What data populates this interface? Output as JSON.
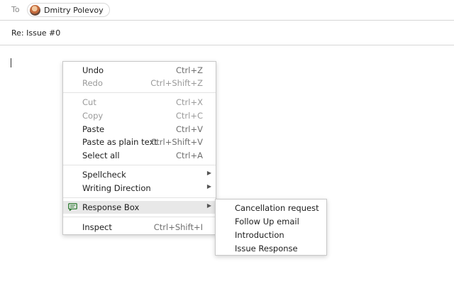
{
  "header": {
    "to_label": "To",
    "recipient_name": "Dmitry Polevoy",
    "subject": "Re: Issue #0"
  },
  "context_menu": {
    "items": [
      {
        "label": "Undo",
        "shortcut": "Ctrl+Z",
        "enabled": true
      },
      {
        "label": "Redo",
        "shortcut": "Ctrl+Shift+Z",
        "enabled": false
      },
      {
        "label": "Cut",
        "shortcut": "Ctrl+X",
        "enabled": false
      },
      {
        "label": "Copy",
        "shortcut": "Ctrl+C",
        "enabled": false
      },
      {
        "label": "Paste",
        "shortcut": "Ctrl+V",
        "enabled": true
      },
      {
        "label": "Paste as plain text",
        "shortcut": "Ctrl+Shift+V",
        "enabled": true
      },
      {
        "label": "Select all",
        "shortcut": "Ctrl+A",
        "enabled": true
      },
      {
        "label": "Spellcheck",
        "submenu": true,
        "enabled": true
      },
      {
        "label": "Writing Direction",
        "submenu": true,
        "enabled": true
      },
      {
        "label": "Response Box",
        "submenu": true,
        "enabled": true,
        "highlighted": true,
        "icon": "chat-bubble-icon"
      },
      {
        "label": "Inspect",
        "shortcut": "Ctrl+Shift+I",
        "enabled": true
      }
    ]
  },
  "response_box_submenu": {
    "items": [
      {
        "label": "Cancellation request"
      },
      {
        "label": "Follow Up email"
      },
      {
        "label": "Introduction"
      },
      {
        "label": "Issue Response"
      }
    ]
  },
  "colors": {
    "menu_highlight": "#e8e8e8",
    "disabled_text": "#9a9a9a",
    "response_box_icon": "#2e7d32"
  }
}
